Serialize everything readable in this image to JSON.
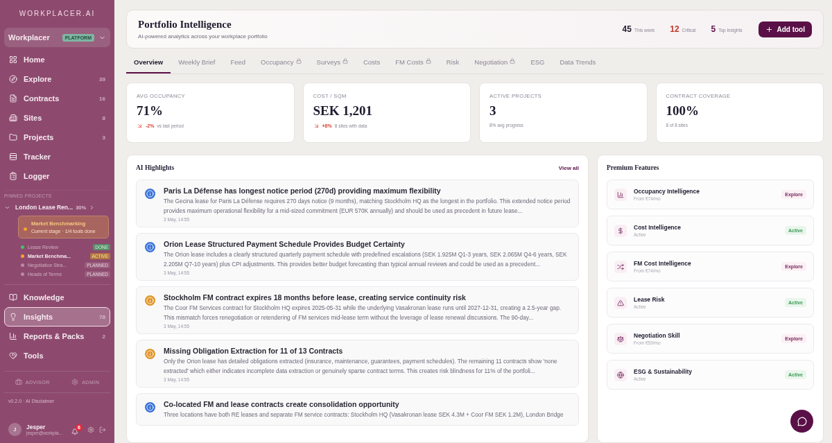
{
  "sidebar": {
    "logo": "WORKPLACER.AI",
    "workspace": {
      "name": "Workplacer",
      "badge": "PLATFORM"
    },
    "nav": [
      {
        "label": "Home",
        "selected": false
      },
      {
        "label": "Explore",
        "count": "39",
        "selected": false
      },
      {
        "label": "Contracts",
        "count": "16",
        "selected": false
      },
      {
        "label": "Sites",
        "count": "8",
        "selected": false
      },
      {
        "label": "Projects",
        "count": "3",
        "selected": false
      },
      {
        "label": "Tracker",
        "selected": false
      },
      {
        "label": "Logger",
        "selected": false
      }
    ],
    "pinned_label": "PINNED PROJECTS",
    "project": {
      "name": "London Lease Ren...",
      "progress": "30%",
      "expanded": true,
      "current": {
        "title": "Market Benchmarking",
        "subtitle": "Current stage · 1/4 tools done"
      },
      "stages": [
        {
          "name": "Lease Review",
          "status": "DONE",
          "kind": "done",
          "color": "#3ec46d"
        },
        {
          "name": "Market Benchma...",
          "status": "ACTIVE",
          "kind": "active",
          "color": "#f2a531"
        },
        {
          "name": "Negotiation Stra...",
          "status": "PLANNED",
          "kind": "planned",
          "color": "#b98ba6"
        },
        {
          "name": "Heads of Terms",
          "status": "PLANNED",
          "kind": "planned",
          "color": "#b98ba6"
        }
      ]
    },
    "nav2": [
      {
        "label": "Knowledge",
        "selected": false
      },
      {
        "label": "Insights",
        "count": "78",
        "selected": true
      },
      {
        "label": "Reports & Packs",
        "count": "2",
        "selected": false
      },
      {
        "label": "Tools",
        "selected": false
      }
    ],
    "roles": [
      "ADVISOR",
      "ADMIN"
    ],
    "version": "v0.2.0 · AI Disclaimer",
    "user": {
      "initial": "J",
      "name": "Jesper",
      "email": "jesper@workpla...",
      "notifications": "6"
    }
  },
  "header": {
    "title": "Portfolio Intelligence",
    "subtitle": "AI-powered analytics across your workplace portfolio",
    "stats": [
      {
        "value": "45",
        "label": "This week",
        "color": "#1e1b2e"
      },
      {
        "value": "12",
        "label": "Critical",
        "color": "#c0392b"
      },
      {
        "value": "5",
        "label": "Top insights",
        "color": "#5a1047"
      }
    ],
    "button": "Add tool"
  },
  "tabs": [
    {
      "label": "Overview",
      "selected": true,
      "locked": false
    },
    {
      "label": "Weekly Brief",
      "selected": false,
      "locked": false
    },
    {
      "label": "Feed",
      "selected": false,
      "locked": false
    },
    {
      "label": "Occupancy",
      "selected": false,
      "locked": true
    },
    {
      "label": "Surveys",
      "selected": false,
      "locked": true
    },
    {
      "label": "Costs",
      "selected": false,
      "locked": false
    },
    {
      "label": "FM Costs",
      "selected": false,
      "locked": true
    },
    {
      "label": "Risk",
      "selected": false,
      "locked": false
    },
    {
      "label": "Negotiation",
      "selected": false,
      "locked": true
    },
    {
      "label": "ESG",
      "selected": false,
      "locked": false
    },
    {
      "label": "Data Trends",
      "selected": false,
      "locked": false
    }
  ],
  "metrics": [
    {
      "label": "AVG OCCUPANCY",
      "value": "71%",
      "delta": "-2%",
      "note": "vs last period"
    },
    {
      "label": "COST / SQM",
      "value": "SEK 1,201",
      "delta": "+8%",
      "note": "8 sites with data"
    },
    {
      "label": "ACTIVE PROJECTS",
      "value": "3",
      "note": "8% avg progress"
    },
    {
      "label": "CONTRACT COVERAGE",
      "value": "100%",
      "note": "8 of 8 sites"
    }
  ],
  "highlights": {
    "title": "AI Highlights",
    "link": "View all",
    "items": [
      {
        "color": "#3b73d9",
        "title": "Paris La Défense has longest notice period (270d) providing maximum flexibility",
        "body": "The Gecina lease for Paris La Défense requires 270 days notice (9 months), matching Stockholm HQ as the longest in the portfolio. This extended notice period provides maximum operational flexibility for a mid-sized commitment (EUR 570K annually) and should be used as precedent in future lease...",
        "date": "3 May, 14:55"
      },
      {
        "color": "#3b73d9",
        "title": "Orion Lease Structured Payment Schedule Provides Budget Certainty",
        "body": "The Orion lease includes a clearly structured quarterly payment schedule with predefined escalations (SEK 1.925M Q1-3 years, SEK 2.065M Q4-6 years, SEK 2.205M Q7-10 years) plus CPI adjustments. This provides better budget forecasting than typical annual reviews and could be used as a precedent...",
        "date": "3 May, 14:55"
      },
      {
        "color": "#e0962a",
        "title": "Stockholm FM contract expires 18 months before lease, creating service continuity risk",
        "body": "The Coor FM Services contract for Stockholm HQ expires 2025-05-31 while the underlying Vasakronan lease runs until 2027-12-31, creating a 2.5-year gap. This mismatch forces renegotiation or retendering of FM services mid-lease term without the leverage of lease renewal discussions. The 90-day...",
        "date": "3 May, 14:55"
      },
      {
        "color": "#e0962a",
        "title": "Missing Obligation Extraction for 11 of 13 Contracts",
        "body": "Only the Orion lease has detailed obligations extracted (insurance, maintenance, guarantees, payment schedules). The remaining 11 contracts show 'none extracted' which either indicates incomplete data extraction or genuinely sparse contract terms. This creates risk blindness for 11% of the portfoli...",
        "date": "3 May, 14:55"
      },
      {
        "color": "#3b73d9",
        "title": "Co-located FM and lease contracts create consolidation opportunity",
        "body": "Three locations have both RE leases and separate FM service contracts: Stockholm HQ (Vasakronan lease SEK 4.3M + Coor FM SEK 1.2M), London Bridge"
      }
    ]
  },
  "premium": {
    "title": "Premium Features",
    "items": [
      {
        "name": "Occupancy Intelligence",
        "detail": "From €74/mo",
        "status": "Explore",
        "kind": "explore"
      },
      {
        "name": "Cost Intelligence",
        "detail": "Active",
        "status": "Active",
        "kind": "active"
      },
      {
        "name": "FM Cost Intelligence",
        "detail": "From €74/mo",
        "status": "Explore",
        "kind": "explore"
      },
      {
        "name": "Lease Risk",
        "detail": "Active",
        "status": "Active",
        "kind": "active"
      },
      {
        "name": "Negotiation Skill",
        "detail": "From €59/mo",
        "status": "Explore",
        "kind": "explore"
      },
      {
        "name": "ESG & Sustainability",
        "detail": "Active",
        "status": "Active",
        "kind": "active"
      }
    ]
  }
}
